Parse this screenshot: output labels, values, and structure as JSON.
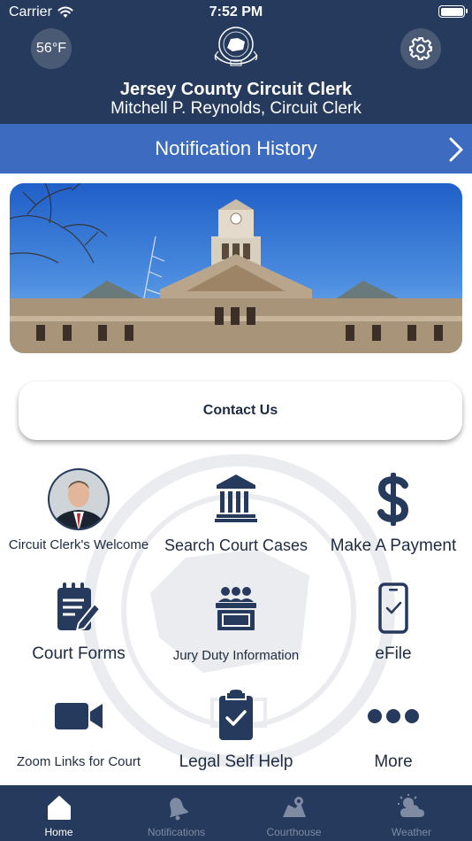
{
  "status_bar": {
    "carrier": "Carrier",
    "time": "7:52 PM"
  },
  "header": {
    "temperature": "56°F",
    "title": "Jersey County Circuit Clerk",
    "subtitle": "Mitchell P. Reynolds, Circuit Clerk"
  },
  "notification_bar": {
    "label": "Notification History"
  },
  "contact": {
    "label": "Contact Us"
  },
  "grid": [
    {
      "label": "Circuit Clerk's Welcome",
      "icon": "clerk-avatar"
    },
    {
      "label": "Search Court Cases",
      "icon": "courthouse-icon"
    },
    {
      "label": "Make A Payment",
      "icon": "dollar-icon"
    },
    {
      "label": "Court Forms",
      "icon": "forms-icon"
    },
    {
      "label": "Jury Duty Information",
      "icon": "jury-box-icon"
    },
    {
      "label": "eFile",
      "icon": "phone-check-icon"
    },
    {
      "label": "Zoom Links for Court",
      "icon": "video-camera-icon"
    },
    {
      "label": "Legal Self Help",
      "icon": "clipboard-check-icon"
    },
    {
      "label": "More",
      "icon": "more-dots-icon"
    }
  ],
  "tabs": [
    {
      "label": "Home",
      "icon": "home-icon",
      "active": true
    },
    {
      "label": "Notifications",
      "icon": "bell-icon",
      "active": false
    },
    {
      "label": "Courthouse",
      "icon": "map-icon",
      "active": false
    },
    {
      "label": "Weather",
      "icon": "weather-icon",
      "active": false
    }
  ],
  "colors": {
    "header_bg": "#253a5c",
    "notification_bar_bg": "#3c6bbf",
    "icon_color": "#253a5c",
    "tab_active": "#ffffff",
    "tab_inactive": "#7f8ba3"
  }
}
